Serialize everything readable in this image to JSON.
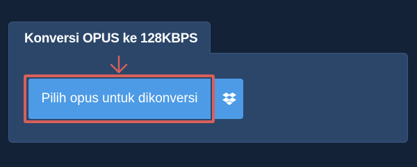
{
  "converter": {
    "title": "Konversi OPUS ke 128KBPS",
    "choose_button_label": "Pilih opus untuk dikonversi",
    "dropbox_icon": "dropbox-icon",
    "arrow_icon": "arrow-down-icon"
  },
  "colors": {
    "background": "#132237",
    "panel": "#2b4669",
    "button": "#4d9be6",
    "highlight": "#d9605b"
  }
}
